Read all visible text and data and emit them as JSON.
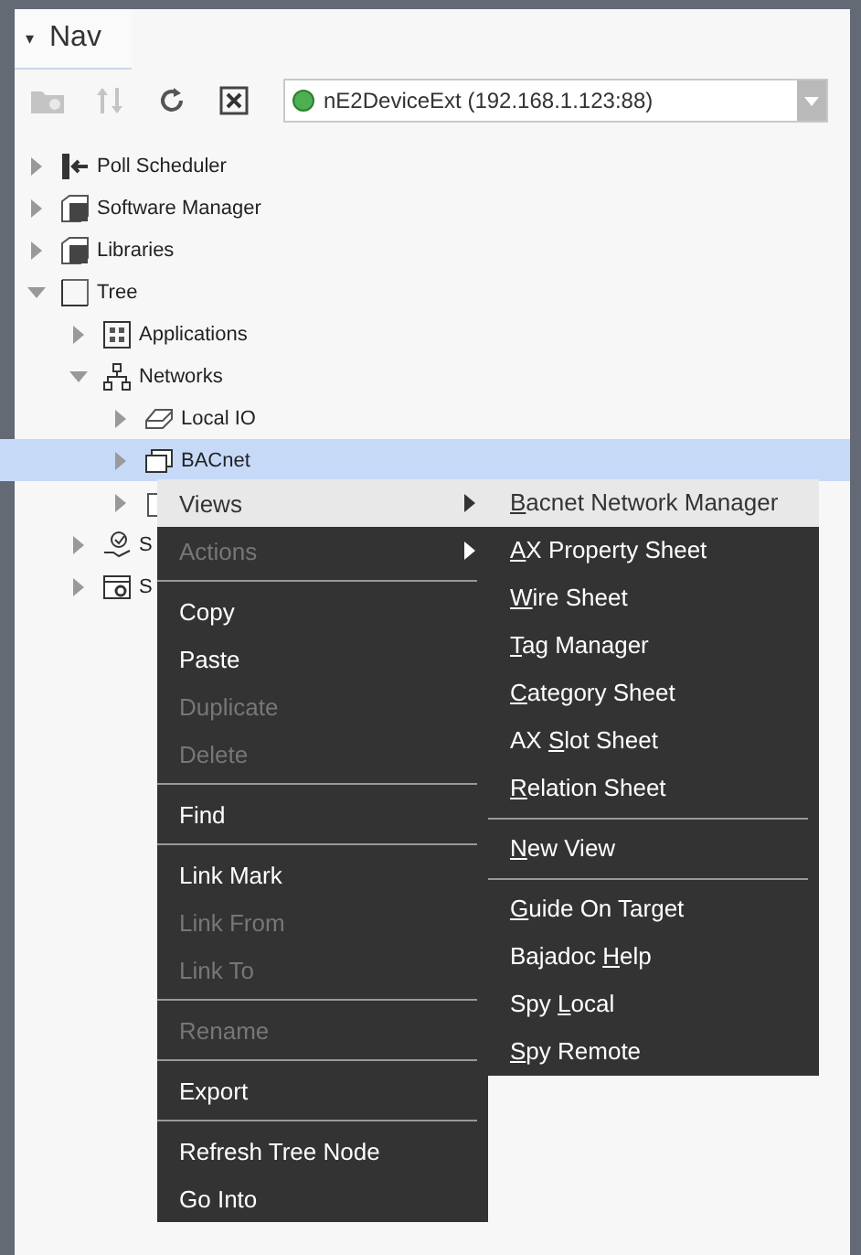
{
  "tab": {
    "arrow": "▾",
    "title": "Nav"
  },
  "station": {
    "online": true,
    "value": "nE2DeviceExt (192.168.1.123:88)"
  },
  "tree": [
    {
      "kind": "scheduler",
      "label": "Poll Scheduler",
      "expanded": false,
      "selected": false
    },
    {
      "kind": "cube",
      "label": "Software Manager",
      "expanded": false,
      "selected": false
    },
    {
      "kind": "cube",
      "label": "Libraries",
      "expanded": false,
      "selected": false
    },
    {
      "kind": "square",
      "label": "Tree",
      "expanded": true,
      "selected": false,
      "children": [
        {
          "kind": "apps",
          "label": "Applications",
          "expanded": false,
          "selected": false
        },
        {
          "kind": "network",
          "label": "Networks",
          "expanded": true,
          "selected": false,
          "children": [
            {
              "kind": "io",
              "label": "Local IO",
              "expanded": false,
              "selected": false
            },
            {
              "kind": "bacnet",
              "label": "BACnet",
              "expanded": false,
              "selected": true
            },
            {
              "kind": "device",
              "expanded": false,
              "selected": false
            }
          ]
        },
        {
          "kind": "service",
          "label": "S",
          "expanded": false,
          "selected": false
        },
        {
          "kind": "system",
          "label": "S",
          "expanded": false,
          "selected": false
        }
      ]
    }
  ],
  "context_menu": [
    {
      "kind": "item",
      "label": "Views",
      "disabled": false,
      "selected": true,
      "submenu": true
    },
    {
      "kind": "item",
      "label": "Actions",
      "disabled": true,
      "selected": false,
      "submenu": true
    },
    {
      "kind": "separator"
    },
    {
      "kind": "item",
      "label": "Copy",
      "disabled": false,
      "selected": false,
      "submenu": false
    },
    {
      "kind": "item",
      "label": "Paste",
      "disabled": false,
      "selected": false,
      "submenu": false
    },
    {
      "kind": "item",
      "label": "Duplicate",
      "disabled": true,
      "selected": false,
      "submenu": false
    },
    {
      "kind": "item",
      "label": "Delete",
      "disabled": true,
      "selected": false,
      "submenu": false
    },
    {
      "kind": "separator"
    },
    {
      "kind": "item",
      "label": "Find",
      "disabled": false,
      "selected": false,
      "submenu": false
    },
    {
      "kind": "separator"
    },
    {
      "kind": "item",
      "label": "Link Mark",
      "disabled": false,
      "selected": false,
      "submenu": false
    },
    {
      "kind": "item",
      "label": "Link From",
      "disabled": true,
      "selected": false,
      "submenu": false
    },
    {
      "kind": "item",
      "label": "Link To",
      "disabled": true,
      "selected": false,
      "submenu": false
    },
    {
      "kind": "separator"
    },
    {
      "kind": "item",
      "label": "Rename",
      "disabled": true,
      "selected": false,
      "submenu": false
    },
    {
      "kind": "separator"
    },
    {
      "kind": "item",
      "label": "Export",
      "disabled": false,
      "selected": false,
      "submenu": false
    },
    {
      "kind": "separator"
    },
    {
      "kind": "item",
      "label": "Refresh Tree Node",
      "disabled": false,
      "selected": false,
      "submenu": false
    },
    {
      "kind": "item",
      "label": "Go Into",
      "disabled": false,
      "selected": false,
      "submenu": false
    }
  ],
  "views_submenu": [
    {
      "kind": "item",
      "key": "B",
      "post": "acnet Network Manager",
      "selected": true
    },
    {
      "kind": "item",
      "key": "A",
      "post": "X Property Sheet",
      "selected": false
    },
    {
      "kind": "item",
      "key": "W",
      "post": "ire Sheet",
      "selected": false
    },
    {
      "kind": "item",
      "key": "T",
      "post": "ag Manager",
      "selected": false
    },
    {
      "kind": "item",
      "key": "C",
      "post": "ategory Sheet",
      "selected": false
    },
    {
      "kind": "item",
      "pre": "AX ",
      "key": "S",
      "post": "lot Sheet",
      "selected": false
    },
    {
      "kind": "item",
      "key": "R",
      "post": "elation Sheet",
      "selected": false
    },
    {
      "kind": "separator"
    },
    {
      "kind": "item",
      "key": "N",
      "post": "ew View",
      "selected": false
    },
    {
      "kind": "separator"
    },
    {
      "kind": "item",
      "key": "G",
      "post": "uide On Target",
      "selected": false
    },
    {
      "kind": "item",
      "pre": "Bajadoc ",
      "key": "H",
      "post": "elp",
      "selected": false
    },
    {
      "kind": "item",
      "pre": "Spy ",
      "key": "L",
      "post": "ocal",
      "selected": false
    },
    {
      "kind": "item",
      "key": "S",
      "post": "py Remote",
      "selected": false
    }
  ]
}
